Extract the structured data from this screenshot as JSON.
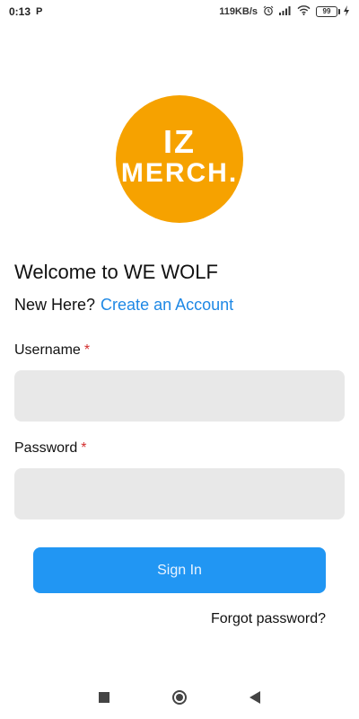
{
  "status_bar": {
    "time": "0:13",
    "app_indicator": "P",
    "network_speed": "119KB/s",
    "battery_level": "99"
  },
  "logo": {
    "top_text": "IZ",
    "bottom_text": "MERCH.",
    "color": "#F6A200"
  },
  "welcome": {
    "title": "Welcome to WE WOLF",
    "new_here": "New Here?",
    "create_account": "Create an Account"
  },
  "form": {
    "username_label": "Username",
    "password_label": "Password",
    "required_mark": "*",
    "username_value": "",
    "password_value": ""
  },
  "actions": {
    "sign_in": "Sign In",
    "forgot_password": "Forgot password?",
    "accent_color": "#2196F3"
  },
  "nav": {
    "icons": [
      "recents-icon",
      "home-icon",
      "back-icon"
    ]
  }
}
